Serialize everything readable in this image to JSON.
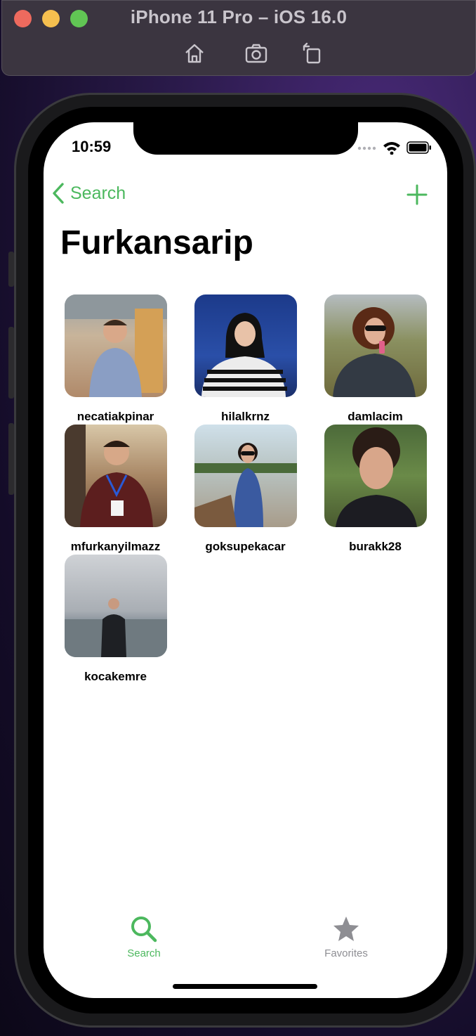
{
  "simulator": {
    "title": "iPhone 11 Pro – iOS 16.0",
    "tools": [
      "home-icon",
      "screenshot-icon",
      "rotate-icon"
    ]
  },
  "status_bar": {
    "time": "10:59"
  },
  "nav": {
    "back_label": "Search",
    "add_icon": "plus-icon"
  },
  "page": {
    "title": "Furkansarip"
  },
  "colors": {
    "accent": "#4cb85e",
    "inactive": "#8e8e93"
  },
  "users": [
    {
      "username": "necatiakpinar"
    },
    {
      "username": "hilalkrnz"
    },
    {
      "username": "damlacim"
    },
    {
      "username": "mfurkanyilmazz"
    },
    {
      "username": "goksupekacar"
    },
    {
      "username": "burakk28"
    },
    {
      "username": "kocakemre"
    }
  ],
  "tabs": [
    {
      "label": "Search",
      "icon": "search-icon",
      "active": true
    },
    {
      "label": "Favorites",
      "icon": "star-icon",
      "active": false
    }
  ]
}
